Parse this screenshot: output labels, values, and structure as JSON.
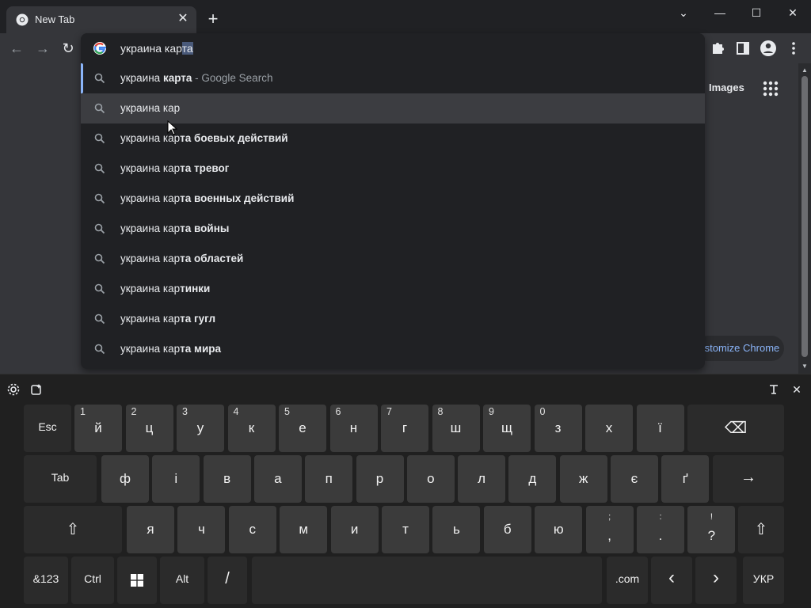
{
  "browser": {
    "tab": {
      "title": "New Tab",
      "close": "✕"
    },
    "new_tab": "+",
    "window": {
      "minimize": "—",
      "maximize": "☐",
      "close": "✕",
      "tab_search": "⌄"
    }
  },
  "toolbar": {
    "back": "←",
    "forward": "→",
    "reload": "↻"
  },
  "omnibox": {
    "typed": "украина кар",
    "autocomplete": "та",
    "suggestions": [
      {
        "prefix": "украина ",
        "bold": "карта",
        "suffix": "",
        "hint_sep": " - ",
        "hint": "Google Search",
        "highlight": false,
        "selected": true
      },
      {
        "prefix": "украина кар",
        "bold": "",
        "suffix": "",
        "highlight": true
      },
      {
        "prefix": "украина кар",
        "bold": "та боевых действий"
      },
      {
        "prefix": "украина кар",
        "bold": "та тревог"
      },
      {
        "prefix": "украина кар",
        "bold": "та военных действий"
      },
      {
        "prefix": "украина кар",
        "bold": "та войны"
      },
      {
        "prefix": "украина кар",
        "bold": "та областей"
      },
      {
        "prefix": "украина кар",
        "bold": "тинки"
      },
      {
        "prefix": "украина кар",
        "bold": "та гугл"
      },
      {
        "prefix": "украина кар",
        "bold": "та мира"
      }
    ]
  },
  "page": {
    "images_link": "Images",
    "customize_label": "ıstomize Chrome"
  },
  "keyboard": {
    "rows": [
      [
        {
          "label": "Esc",
          "type": "fn"
        },
        {
          "main": "й",
          "num": "1"
        },
        {
          "main": "ц",
          "num": "2"
        },
        {
          "main": "у",
          "num": "3"
        },
        {
          "main": "к",
          "num": "4"
        },
        {
          "main": "е",
          "num": "5"
        },
        {
          "main": "н",
          "num": "6"
        },
        {
          "main": "г",
          "num": "7"
        },
        {
          "main": "ш",
          "num": "8"
        },
        {
          "main": "щ",
          "num": "9"
        },
        {
          "main": "з",
          "num": "0"
        },
        {
          "main": "х"
        },
        {
          "main": "ї"
        },
        {
          "label": "⌫",
          "type": "backspace"
        }
      ],
      [
        {
          "label": "Tab",
          "type": "fn"
        },
        {
          "main": "ф"
        },
        {
          "main": "і"
        },
        {
          "main": "в"
        },
        {
          "main": "а"
        },
        {
          "main": "п"
        },
        {
          "main": "р"
        },
        {
          "main": "о"
        },
        {
          "main": "л"
        },
        {
          "main": "д"
        },
        {
          "main": "ж"
        },
        {
          "main": "є"
        },
        {
          "main": "ґ"
        },
        {
          "label": "→",
          "type": "enter"
        }
      ],
      [
        {
          "label": "⇧",
          "type": "shift-left"
        },
        {
          "main": "я"
        },
        {
          "main": "ч"
        },
        {
          "main": "с"
        },
        {
          "main": "м"
        },
        {
          "main": "и"
        },
        {
          "main": "т"
        },
        {
          "main": "ь"
        },
        {
          "main": "б"
        },
        {
          "main": "ю"
        },
        {
          "top": ";",
          "bottom": ","
        },
        {
          "top": ":",
          "bottom": "."
        },
        {
          "top": "!",
          "bottom": "?"
        },
        {
          "label": "⇧",
          "type": "shift-right"
        }
      ],
      [
        {
          "label": "&123",
          "type": "fn"
        },
        {
          "label": "Ctrl",
          "type": "fn"
        },
        {
          "label": "win",
          "type": "win"
        },
        {
          "label": "Alt",
          "type": "fn"
        },
        {
          "label": "/",
          "type": "fn"
        },
        {
          "label": "",
          "type": "space"
        },
        {
          "label": ".com",
          "type": "fn"
        },
        {
          "label": "‹",
          "type": "fn"
        },
        {
          "label": "›",
          "type": "fn"
        },
        {
          "label": "УКР",
          "type": "fn"
        }
      ]
    ]
  },
  "colors": {
    "accent": "#8ab4f8",
    "bg": "#202124",
    "toolbar": "#35363a",
    "key": "#3b3b3b"
  }
}
